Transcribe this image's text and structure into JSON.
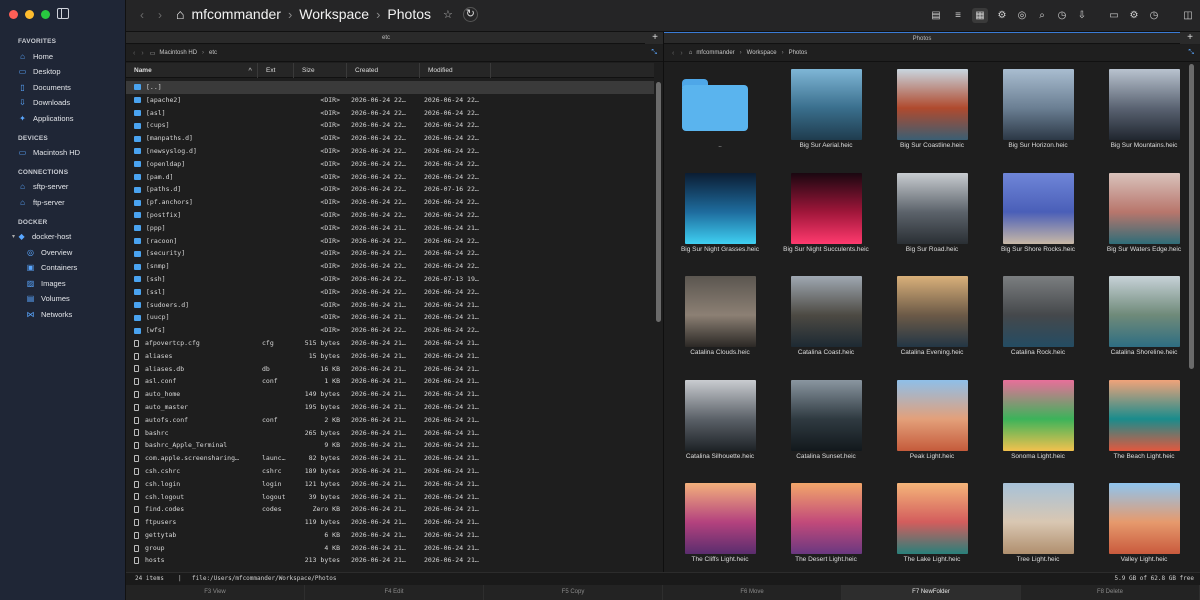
{
  "sidebar": {
    "sections": {
      "favorites": "FAVORITES",
      "devices": "DEVICES",
      "connections": "CONNECTIONS",
      "docker": "DOCKER"
    },
    "favorites": [
      {
        "label": "Home",
        "icon": "house-icon"
      },
      {
        "label": "Desktop",
        "icon": "desktop-icon"
      },
      {
        "label": "Documents",
        "icon": "document-icon"
      },
      {
        "label": "Downloads",
        "icon": "download-icon"
      },
      {
        "label": "Applications",
        "icon": "applications-icon"
      }
    ],
    "devices": [
      {
        "label": "Macintosh HD",
        "icon": "disk-icon"
      }
    ],
    "connections": [
      {
        "label": "sftp-server",
        "icon": "server-icon"
      },
      {
        "label": "ftp-server",
        "icon": "server-icon"
      }
    ],
    "docker_host": "docker-host",
    "docker_items": [
      "Overview",
      "Containers",
      "Images",
      "Volumes",
      "Networks"
    ]
  },
  "toolbar": {
    "breadcrumb": [
      "mfcommander",
      "Workspace",
      "Photos"
    ]
  },
  "left_pane": {
    "tab_title": "etc",
    "path": [
      "Macintosh HD",
      "etc"
    ],
    "columns": [
      "Name",
      "Ext",
      "Size",
      "Created",
      "Modified"
    ],
    "rows": [
      {
        "name": "[..]",
        "ext": "",
        "size": "",
        "created": "",
        "modified": "",
        "folder": true,
        "selected": true
      },
      {
        "name": "[apache2]",
        "ext": "",
        "size": "<DIR>",
        "created": "2026-06-24 22…",
        "modified": "2026-06-24 22…",
        "folder": true
      },
      {
        "name": "[asl]",
        "ext": "",
        "size": "<DIR>",
        "created": "2026-06-24 22…",
        "modified": "2026-06-24 22…",
        "folder": true
      },
      {
        "name": "[cups]",
        "ext": "",
        "size": "<DIR>",
        "created": "2026-06-24 22…",
        "modified": "2026-06-24 22…",
        "folder": true
      },
      {
        "name": "[manpaths.d]",
        "ext": "",
        "size": "<DIR>",
        "created": "2026-06-24 22…",
        "modified": "2026-06-24 22…",
        "folder": true
      },
      {
        "name": "[newsyslog.d]",
        "ext": "",
        "size": "<DIR>",
        "created": "2026-06-24 22…",
        "modified": "2026-06-24 22…",
        "folder": true
      },
      {
        "name": "[openldap]",
        "ext": "",
        "size": "<DIR>",
        "created": "2026-06-24 22…",
        "modified": "2026-06-24 22…",
        "folder": true
      },
      {
        "name": "[pam.d]",
        "ext": "",
        "size": "<DIR>",
        "created": "2026-06-24 22…",
        "modified": "2026-06-24 22…",
        "folder": true
      },
      {
        "name": "[paths.d]",
        "ext": "",
        "size": "<DIR>",
        "created": "2026-06-24 22…",
        "modified": "2026-07-16 22…",
        "folder": true
      },
      {
        "name": "[pf.anchors]",
        "ext": "",
        "size": "<DIR>",
        "created": "2026-06-24 22…",
        "modified": "2026-06-24 22…",
        "folder": true
      },
      {
        "name": "[postfix]",
        "ext": "",
        "size": "<DIR>",
        "created": "2026-06-24 22…",
        "modified": "2026-06-24 22…",
        "folder": true
      },
      {
        "name": "[ppp]",
        "ext": "",
        "size": "<DIR>",
        "created": "2026-06-24 21…",
        "modified": "2026-06-24 21…",
        "folder": true
      },
      {
        "name": "[racoon]",
        "ext": "",
        "size": "<DIR>",
        "created": "2026-06-24 22…",
        "modified": "2026-06-24 22…",
        "folder": true
      },
      {
        "name": "[security]",
        "ext": "",
        "size": "<DIR>",
        "created": "2026-06-24 22…",
        "modified": "2026-06-24 22…",
        "folder": true
      },
      {
        "name": "[snmp]",
        "ext": "",
        "size": "<DIR>",
        "created": "2026-06-24 22…",
        "modified": "2026-06-24 22…",
        "folder": true
      },
      {
        "name": "[ssh]",
        "ext": "",
        "size": "<DIR>",
        "created": "2026-06-24 22…",
        "modified": "2026-07-13 19…",
        "folder": true
      },
      {
        "name": "[ssl]",
        "ext": "",
        "size": "<DIR>",
        "created": "2026-06-24 22…",
        "modified": "2026-06-24 22…",
        "folder": true
      },
      {
        "name": "[sudoers.d]",
        "ext": "",
        "size": "<DIR>",
        "created": "2026-06-24 21…",
        "modified": "2026-06-24 21…",
        "folder": true
      },
      {
        "name": "[uucp]",
        "ext": "",
        "size": "<DIR>",
        "created": "2026-06-24 21…",
        "modified": "2026-06-24 21…",
        "folder": true
      },
      {
        "name": "[wfs]",
        "ext": "",
        "size": "<DIR>",
        "created": "2026-06-24 22…",
        "modified": "2026-06-24 22…",
        "folder": true
      },
      {
        "name": "afpovertcp.cfg",
        "ext": "cfg",
        "size": "515 bytes",
        "created": "2026-06-24 21…",
        "modified": "2026-06-24 21…",
        "folder": false
      },
      {
        "name": "aliases",
        "ext": "",
        "size": "15 bytes",
        "created": "2026-06-24 21…",
        "modified": "2026-06-24 21…",
        "folder": false
      },
      {
        "name": "aliases.db",
        "ext": "db",
        "size": "16 KB",
        "created": "2026-06-24 21…",
        "modified": "2026-06-24 21…",
        "folder": false
      },
      {
        "name": "asl.conf",
        "ext": "conf",
        "size": "1 KB",
        "created": "2026-06-24 21…",
        "modified": "2026-06-24 21…",
        "folder": false
      },
      {
        "name": "auto_home",
        "ext": "",
        "size": "149 bytes",
        "created": "2026-06-24 21…",
        "modified": "2026-06-24 21…",
        "folder": false
      },
      {
        "name": "auto_master",
        "ext": "",
        "size": "195 bytes",
        "created": "2026-06-24 21…",
        "modified": "2026-06-24 21…",
        "folder": false
      },
      {
        "name": "autofs.conf",
        "ext": "conf",
        "size": "2 KB",
        "created": "2026-06-24 21…",
        "modified": "2026-06-24 21…",
        "folder": false
      },
      {
        "name": "bashrc",
        "ext": "",
        "size": "265 bytes",
        "created": "2026-06-24 21…",
        "modified": "2026-06-24 21…",
        "folder": false
      },
      {
        "name": "bashrc_Apple_Terminal",
        "ext": "",
        "size": "9 KB",
        "created": "2026-06-24 21…",
        "modified": "2026-06-24 21…",
        "folder": false
      },
      {
        "name": "com.apple.screensharing…",
        "ext": "launc…",
        "size": "82 bytes",
        "created": "2026-06-24 21…",
        "modified": "2026-06-24 21…",
        "folder": false
      },
      {
        "name": "csh.cshrc",
        "ext": "cshrc",
        "size": "189 bytes",
        "created": "2026-06-24 21…",
        "modified": "2026-06-24 21…",
        "folder": false
      },
      {
        "name": "csh.login",
        "ext": "login",
        "size": "121 bytes",
        "created": "2026-06-24 21…",
        "modified": "2026-06-24 21…",
        "folder": false
      },
      {
        "name": "csh.logout",
        "ext": "logout",
        "size": "39 bytes",
        "created": "2026-06-24 21…",
        "modified": "2026-06-24 21…",
        "folder": false
      },
      {
        "name": "find.codes",
        "ext": "codes",
        "size": "Zero KB",
        "created": "2026-06-24 21…",
        "modified": "2026-06-24 21…",
        "folder": false
      },
      {
        "name": "ftpusers",
        "ext": "",
        "size": "119 bytes",
        "created": "2026-06-24 21…",
        "modified": "2026-06-24 21…",
        "folder": false
      },
      {
        "name": "gettytab",
        "ext": "",
        "size": "6 KB",
        "created": "2026-06-24 21…",
        "modified": "2026-06-24 21…",
        "folder": false
      },
      {
        "name": "group",
        "ext": "",
        "size": "4 KB",
        "created": "2026-06-24 21…",
        "modified": "2026-06-24 21…",
        "folder": false
      },
      {
        "name": "hosts",
        "ext": "",
        "size": "213 bytes",
        "created": "2026-06-24 21…",
        "modified": "2026-06-24 21…",
        "folder": false
      }
    ]
  },
  "right_pane": {
    "tab_title": "Photos",
    "path": [
      "mfcommander",
      "Workspace",
      "Photos"
    ],
    "items": [
      {
        "label": "..",
        "folder": true
      },
      {
        "label": "Big Sur Aerial.heic",
        "colors": [
          "#7fb6d6",
          "#3a6f8d",
          "#1f3c4e"
        ]
      },
      {
        "label": "Big Sur Coastline.heic",
        "colors": [
          "#c9d6e0",
          "#b04a2e",
          "#3a5e73"
        ]
      },
      {
        "label": "Big Sur Horizon.heic",
        "colors": [
          "#a9bdd0",
          "#6b7f93",
          "#2c3846"
        ]
      },
      {
        "label": "Big Sur Mountains.heic",
        "colors": [
          "#b9c3cf",
          "#5a6372",
          "#20262f"
        ]
      },
      {
        "label": "Big Sur Night Grasses.heic",
        "colors": [
          "#0b1d33",
          "#1e6c9e",
          "#3fd0f2"
        ]
      },
      {
        "label": "Big Sur Night Succulents.heic",
        "colors": [
          "#1a0710",
          "#a0163a",
          "#ff3a6e"
        ]
      },
      {
        "label": "Big Sur Road.heic",
        "colors": [
          "#c8ccd0",
          "#5c636b",
          "#2a2f34"
        ]
      },
      {
        "label": "Big Sur Shore Rocks.heic",
        "colors": [
          "#6f86d8",
          "#4a5fb8",
          "#c8b8a6"
        ]
      },
      {
        "label": "Big Sur Waters Edge.heic",
        "colors": [
          "#d9c2bb",
          "#b8766c",
          "#2f6d78"
        ]
      },
      {
        "label": "Catalina Clouds.heic",
        "colors": [
          "#5b5650",
          "#8c8074",
          "#2b2825"
        ]
      },
      {
        "label": "Catalina Coast.heic",
        "colors": [
          "#9fa8b2",
          "#4d4a43",
          "#1d2a33"
        ]
      },
      {
        "label": "Catalina Evening.heic",
        "colors": [
          "#d9b07a",
          "#6c5a47",
          "#233645"
        ]
      },
      {
        "label": "Catalina Rock.heic",
        "colors": [
          "#7b7e80",
          "#45484b",
          "#244c63"
        ]
      },
      {
        "label": "Catalina Shoreline.heic",
        "colors": [
          "#c7d2d8",
          "#6f8a79",
          "#2e6e82"
        ]
      },
      {
        "label": "Catalina Silhouette.heic",
        "colors": [
          "#c9ccd0",
          "#5b6168",
          "#1d2226"
        ]
      },
      {
        "label": "Catalina Sunset.heic",
        "colors": [
          "#8a96a0",
          "#2f3a41",
          "#12181c"
        ]
      },
      {
        "label": "Peak Light.heic",
        "colors": [
          "#8fbfe8",
          "#e3a07a",
          "#c55b3b"
        ]
      },
      {
        "label": "Sonoma Light.heic",
        "colors": [
          "#e86f9a",
          "#3cb35a",
          "#f2c14e"
        ]
      },
      {
        "label": "The Beach Light.heic",
        "colors": [
          "#f0a37a",
          "#1a8c8c",
          "#e2583e"
        ]
      },
      {
        "label": "The Cliffs Light.heic",
        "colors": [
          "#f3b07c",
          "#b4427e",
          "#5a2d6e"
        ]
      },
      {
        "label": "The Desert Light.heic",
        "colors": [
          "#f2a66a",
          "#c24a7a",
          "#6a3880"
        ]
      },
      {
        "label": "The Lake Light.heic",
        "colors": [
          "#f5b57a",
          "#d35d5d",
          "#29807a"
        ]
      },
      {
        "label": "Tree Light.heic",
        "colors": [
          "#a7c2d9",
          "#d9c7b2",
          "#b08f6e"
        ]
      },
      {
        "label": "Valley Light.heic",
        "colors": [
          "#8fc5ef",
          "#e69a6d",
          "#c95a3d"
        ]
      }
    ]
  },
  "status": {
    "left": "24 items",
    "path": "file:/Users/mfcommander/Workspace/Photos",
    "right": "5.9 GB of 62.8 GB free"
  },
  "fkeys": [
    "F3 View",
    "F4 Edit",
    "F5 Copy",
    "F6 Move",
    "F7 NewFolder",
    "F8 Delete"
  ]
}
